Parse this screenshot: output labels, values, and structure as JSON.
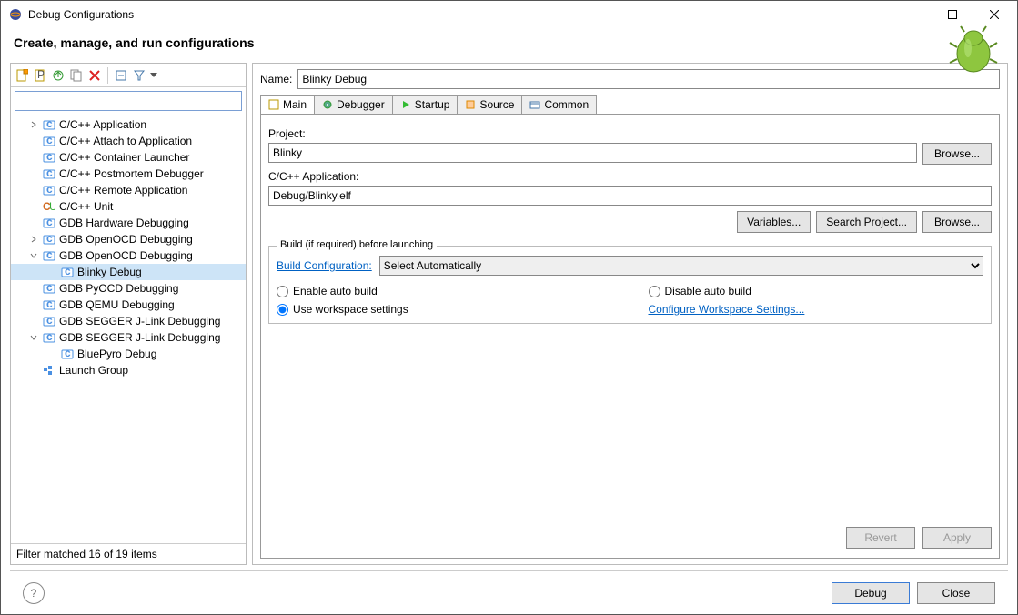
{
  "window_title": "Debug Configurations",
  "header_title": "Create, manage, and run configurations",
  "filter_value": "",
  "tree": [
    {
      "label": "C/C++ Application",
      "arrow": ">",
      "icon": "c",
      "level": 1
    },
    {
      "label": "C/C++ Attach to Application",
      "icon": "c",
      "level": 1
    },
    {
      "label": "C/C++ Container Launcher",
      "icon": "c",
      "level": 1
    },
    {
      "label": "C/C++ Postmortem Debugger",
      "icon": "c",
      "level": 1
    },
    {
      "label": "C/C++ Remote Application",
      "icon": "c",
      "level": 1
    },
    {
      "label": "C/C++ Unit",
      "icon": "cu",
      "level": 1
    },
    {
      "label": "GDB Hardware Debugging",
      "icon": "c",
      "level": 1
    },
    {
      "label": "GDB OpenOCD Debugging",
      "arrow": ">",
      "icon": "c",
      "level": 1
    },
    {
      "label": "GDB OpenOCD Debugging",
      "arrow": "v",
      "icon": "c",
      "level": 1
    },
    {
      "label": "Blinky Debug",
      "icon": "c",
      "level": 2,
      "selected": true
    },
    {
      "label": "GDB PyOCD Debugging",
      "icon": "c",
      "level": 1
    },
    {
      "label": "GDB QEMU Debugging",
      "icon": "c",
      "level": 1
    },
    {
      "label": "GDB SEGGER J-Link Debugging",
      "icon": "c",
      "level": 1
    },
    {
      "label": "GDB SEGGER J-Link Debugging",
      "arrow": "v",
      "icon": "c",
      "level": 1
    },
    {
      "label": "BluePyro Debug",
      "icon": "c",
      "level": 2
    },
    {
      "label": "Launch Group",
      "icon": "g",
      "level": 1
    }
  ],
  "status_text": "Filter matched 16 of 19 items",
  "name_label": "Name:",
  "name_value": "Blinky Debug",
  "tabs": [
    "Main",
    "Debugger",
    "Startup",
    "Source",
    "Common"
  ],
  "project_label": "Project:",
  "project_value": "Blinky",
  "browse_label": "Browse...",
  "app_label": "C/C++ Application:",
  "app_value": "Debug/Blinky.elf",
  "variables_label": "Variables...",
  "search_project_label": "Search Project...",
  "build_legend": "Build (if required) before launching",
  "build_config_label": "Build Configuration:",
  "build_config_value": "Select Automatically",
  "enable_auto_label": "Enable auto build",
  "disable_auto_label": "Disable auto build",
  "use_workspace_label": "Use workspace settings",
  "configure_ws_label": "Configure Workspace Settings...",
  "revert_label": "Revert",
  "apply_label": "Apply",
  "debug_label": "Debug",
  "close_label": "Close"
}
